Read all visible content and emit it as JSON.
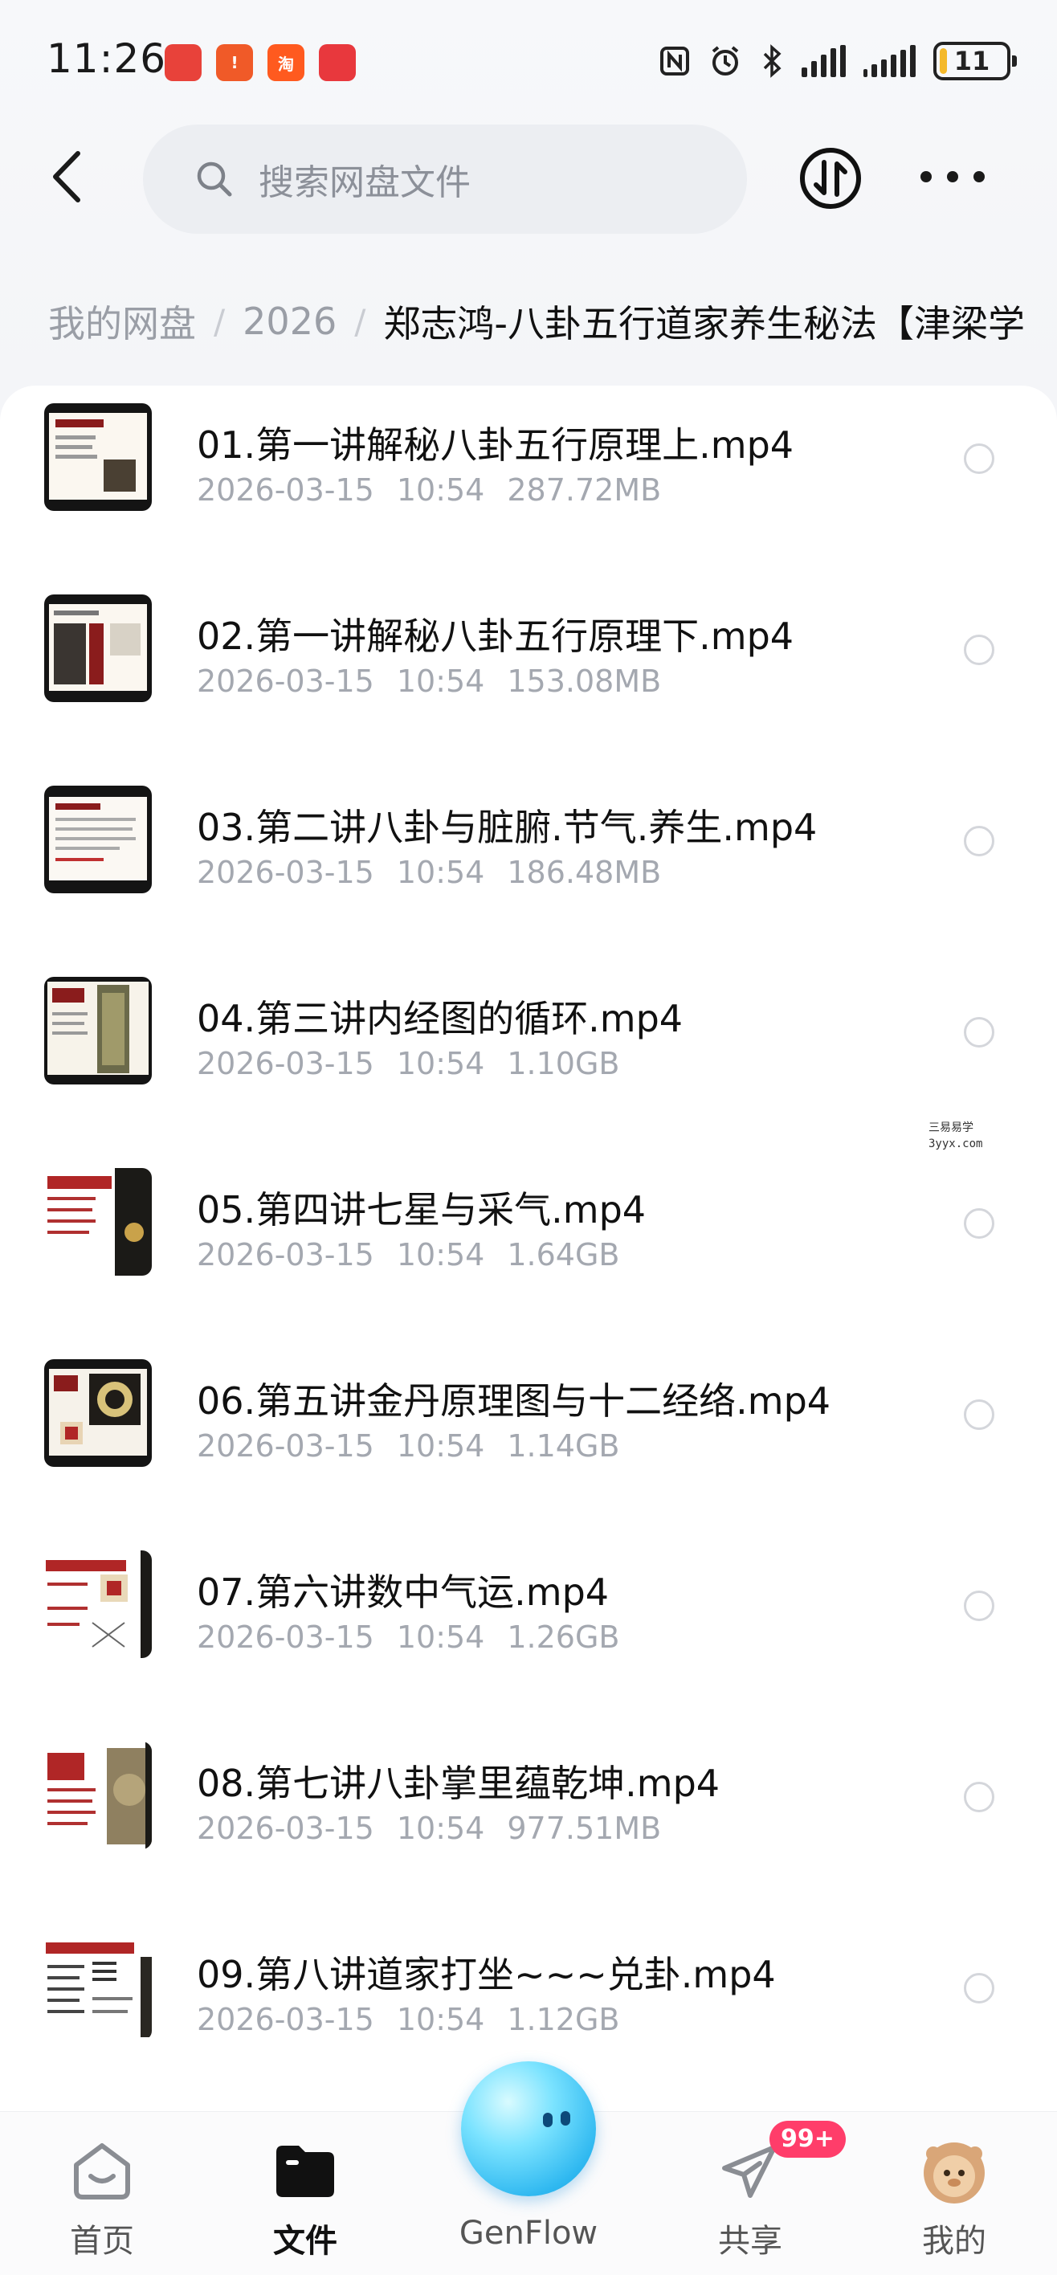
{
  "status_bar": {
    "time": "11:26",
    "apps": [
      {
        "icon": "huawei-app-icon",
        "color": "#e8423a",
        "label": ""
      },
      {
        "icon": "alert-app-icon",
        "color": "#f05a28",
        "label": "!"
      },
      {
        "icon": "taobao-app-icon",
        "color": "#ff5a1f",
        "label": "淘"
      },
      {
        "icon": "message-app-icon",
        "color": "#e8383d",
        "label": ""
      }
    ],
    "battery": "11",
    "battery_level": 0.11
  },
  "header": {
    "search_placeholder": "搜索网盘文件"
  },
  "breadcrumb": {
    "items": [
      "我的网盘",
      "2026"
    ],
    "current": "郑志鸿-八卦五行道家养生秘法【津梁学"
  },
  "files": [
    {
      "name": "01.第一讲解秘八卦五行原理上.mp4",
      "date": "2026-03-15",
      "time": "10:54",
      "size": "287.72MB"
    },
    {
      "name": "02.第一讲解秘八卦五行原理下.mp4",
      "date": "2026-03-15",
      "time": "10:54",
      "size": "153.08MB"
    },
    {
      "name": "03.第二讲八卦与脏腑.节气.养生.mp4",
      "date": "2026-03-15",
      "time": "10:54",
      "size": "186.48MB"
    },
    {
      "name": "04.第三讲内经图的循环.mp4",
      "date": "2026-03-15",
      "time": "10:54",
      "size": "1.10GB"
    },
    {
      "name": "05.第四讲七星与采气.mp4",
      "date": "2026-03-15",
      "time": "10:54",
      "size": "1.64GB"
    },
    {
      "name": "06.第五讲金丹原理图与十二经络.mp4",
      "date": "2026-03-15",
      "time": "10:54",
      "size": "1.14GB"
    },
    {
      "name": "07.第六讲数中气运.mp4",
      "date": "2026-03-15",
      "time": "10:54",
      "size": "1.26GB"
    },
    {
      "name": "08.第七讲八卦掌里蕴乾坤.mp4",
      "date": "2026-03-15",
      "time": "10:54",
      "size": "977.51MB"
    },
    {
      "name": "09.第八讲道家打坐~~~兑卦.mp4",
      "date": "2026-03-15",
      "time": "10:54",
      "size": "1.12GB"
    }
  ],
  "watermark": {
    "line1": "三易易学",
    "line2": "3yyx.com"
  },
  "bottom_nav": {
    "home": "首页",
    "files": "文件",
    "genflow": "GenFlow",
    "share": "共享",
    "share_badge": "99+",
    "mine": "我的"
  },
  "colors": {
    "accent": "#111111",
    "badge": "#ff3d6a",
    "orb": "#2fb8f0"
  }
}
